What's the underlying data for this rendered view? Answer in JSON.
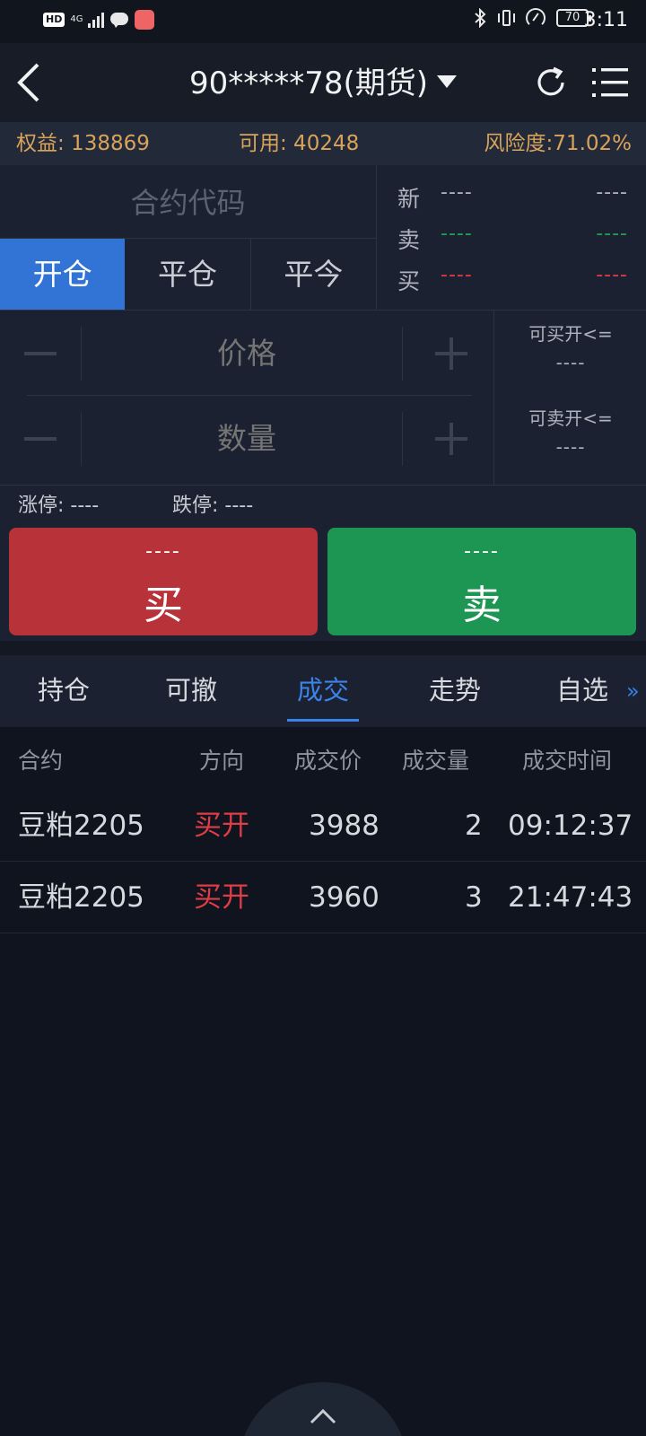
{
  "status_bar": {
    "hd": "HD",
    "network": "4G",
    "battery": "70",
    "time": "3:11"
  },
  "nav": {
    "title": "90*****78(期货)"
  },
  "account": {
    "equity": "权益: 138869",
    "available": "可用: 40248",
    "risk": "风险度:71.02%"
  },
  "order": {
    "contract_placeholder": "合约代码",
    "position_tabs": [
      "开仓",
      "平仓",
      "平今"
    ],
    "quote": [
      {
        "label": "新",
        "v1": "----",
        "v2": "----"
      },
      {
        "label": "卖",
        "v1": "----",
        "v2": "----"
      },
      {
        "label": "买",
        "v1": "----",
        "v2": "----"
      }
    ],
    "price_placeholder": "价格",
    "quantity_placeholder": "数量",
    "max_buy_label": "可买开<=",
    "max_buy_value": "----",
    "max_sell_label": "可卖开<=",
    "max_sell_value": "----",
    "limit_up": "涨停: ----",
    "limit_down": "跌停: ----",
    "buy_price": "----",
    "buy_label": "买",
    "sell_price": "----",
    "sell_label": "卖"
  },
  "tabs": [
    "持仓",
    "可撤",
    "成交",
    "走势",
    "自选"
  ],
  "active_tab": "成交",
  "more_icon": "»",
  "trades": {
    "headers": [
      "合约",
      "方向",
      "成交价",
      "成交量",
      "成交时间"
    ],
    "rows": [
      [
        "豆粕2205",
        "买开",
        "3988",
        "2",
        "09:12:37"
      ],
      [
        "豆粕2205",
        "买开",
        "3960",
        "3",
        "21:47:43"
      ]
    ]
  },
  "colors": {
    "accent": "#3b83e8",
    "buy": "#b8323a",
    "sell": "#1e9653",
    "account_text": "#d9a35a"
  }
}
